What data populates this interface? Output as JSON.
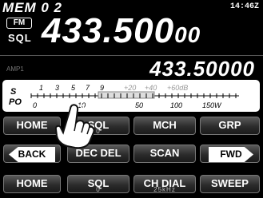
{
  "header": {
    "memory": "MEM 0 2",
    "time": "14:46Z",
    "mode": "FM",
    "sql_indicator": "SQL",
    "main_freq_major": "433.500",
    "main_freq_minor": "00",
    "amp_label": "AMP1",
    "sub_freq": "433.50000"
  },
  "meter": {
    "s_label": "S",
    "po_label": "PO",
    "s_scale": [
      "1",
      "3",
      "5",
      "7",
      "9",
      "+20",
      "+40",
      "+60dB"
    ],
    "po_scale": [
      "0",
      "10",
      "50",
      "100",
      "150W"
    ]
  },
  "buttons": {
    "row1": [
      "HOME",
      "SQL",
      "MCH",
      "GRP"
    ],
    "row2": [
      "BACK",
      "DEC DEL",
      "SCAN",
      "FWD"
    ],
    "row3": [
      "HOME",
      "SQL",
      "CH DIAL",
      "SWEEP"
    ],
    "row1_sub": [
      "",
      "0",
      "",
      ""
    ],
    "row3_sub": [
      "",
      "0",
      "25kHz",
      ""
    ]
  }
}
